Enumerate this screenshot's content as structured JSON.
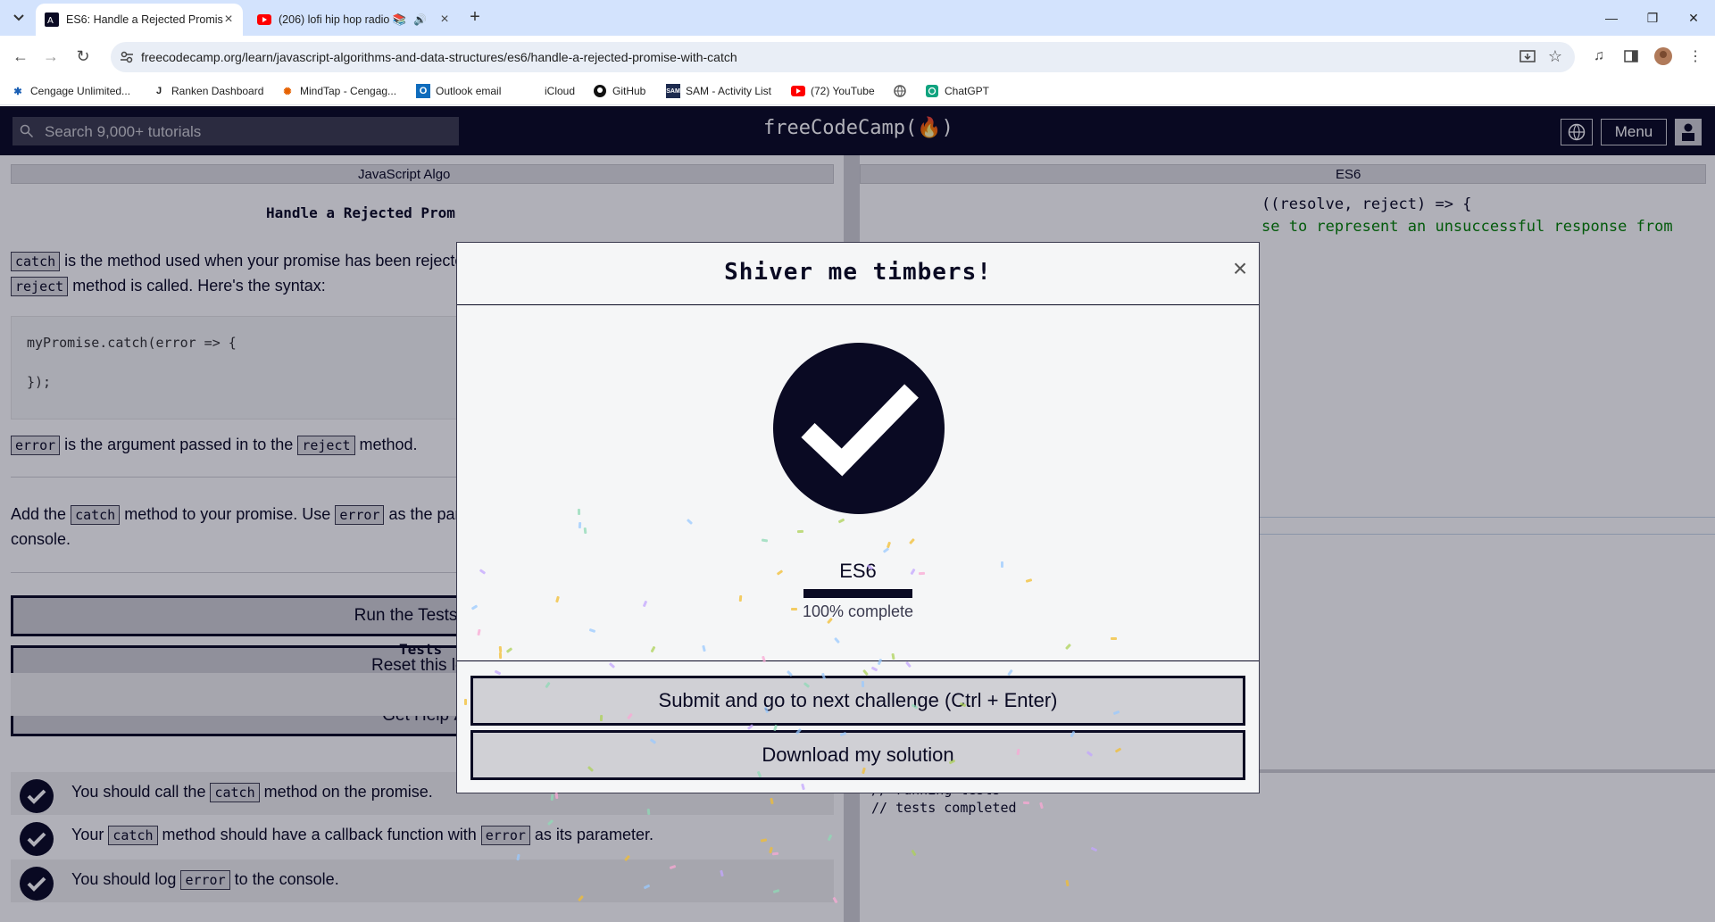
{
  "browser": {
    "tabs": [
      {
        "title": "ES6: Handle a Rejected Promis",
        "active": true,
        "favicon": "freecodecamp-icon"
      },
      {
        "title": "(206) lofi hip hop radio 📚",
        "active": false,
        "favicon": "youtube-icon"
      }
    ],
    "url": "freecodecamp.org/learn/javascript-algorithms-and-data-structures/es6/handle-a-rejected-promise-with-catch",
    "bookmarks": [
      {
        "label": "Cengage Unlimited...",
        "icon": "cengage-icon",
        "color": "#1a5fb4"
      },
      {
        "label": "Ranken Dashboard",
        "icon": "ranken-icon",
        "color": "#222222"
      },
      {
        "label": "MindTap - Cengag...",
        "icon": "mindtap-icon",
        "color": "#e66100"
      },
      {
        "label": "Outlook email",
        "icon": "outlook-icon",
        "color": "#0f6cbd"
      },
      {
        "label": "iCloud",
        "icon": "apple-icon",
        "color": "#555555"
      },
      {
        "label": "GitHub",
        "icon": "github-icon",
        "color": "#111111"
      },
      {
        "label": "SAM - Activity List",
        "icon": "sam-icon",
        "color": "#1d2b4f"
      },
      {
        "label": "(72) YouTube",
        "icon": "youtube-icon",
        "color": "#ff0000"
      },
      {
        "label": "",
        "icon": "globe-icon",
        "color": "#555555"
      },
      {
        "label": "ChatGPT",
        "icon": "chatgpt-icon",
        "color": "#10a37f"
      }
    ]
  },
  "fcc": {
    "search_placeholder": "Search 9,000+ tutorials",
    "logo": "freeCodeCamp(🔥)",
    "menu_label": "Menu",
    "left": {
      "breadcrumb": "JavaScript Algo",
      "lesson_title": "Handle a Rejected Prom",
      "p1": {
        "code1": "catch",
        "text1": " is the method used when your promise has been rejecte",
        "code2": "reject",
        "text2": " method is called. Here's the syntax:"
      },
      "code_lines": [
        "myPromise.catch(error => {",
        "",
        "});"
      ],
      "p2": {
        "code1": "error",
        "text1": " is the argument passed in to the ",
        "code2": "reject",
        "text2": " method."
      },
      "p3": {
        "text1": "Add the ",
        "code1": "catch",
        "text2": " method to your promise. Use ",
        "code2": "error",
        "text3": " as the para",
        "line2": "console."
      },
      "run_button": "Run the Tests (Ctr",
      "reset_button": "Reset this les",
      "help_button": "Get Help ▴",
      "tests_heading": "Tests",
      "tests": [
        {
          "pre": "You should call the ",
          "code": "catch",
          "post": " method on the promise."
        },
        {
          "pre": "Your ",
          "code": "catch",
          "post": " method should have a callback function with ",
          "code2": "error",
          "post2": " as its parameter."
        },
        {
          "pre": "You should log ",
          "code": "error",
          "post": " to the console."
        }
      ]
    },
    "right": {
      "breadcrumb": "ES6",
      "editor_line1": "((resolve, reject) => {",
      "editor_line2": "se to represent an unsuccessful response from",
      "console_lines": [
        "// running tests",
        "// tests completed"
      ]
    }
  },
  "modal": {
    "title": "Shiver me timbers!",
    "close": "×",
    "cert_name": "ES6",
    "progress_fraction": 1.0,
    "progress_text": "100% complete",
    "submit_button": "Submit and go to next challenge (Ctrl + Enter)",
    "download_button": "Download my solution"
  },
  "colors": {
    "fcc_dark": "#0a0a23",
    "chrome_tabbar": "#d3e3fd",
    "button_gray": "#d0d0d5"
  }
}
